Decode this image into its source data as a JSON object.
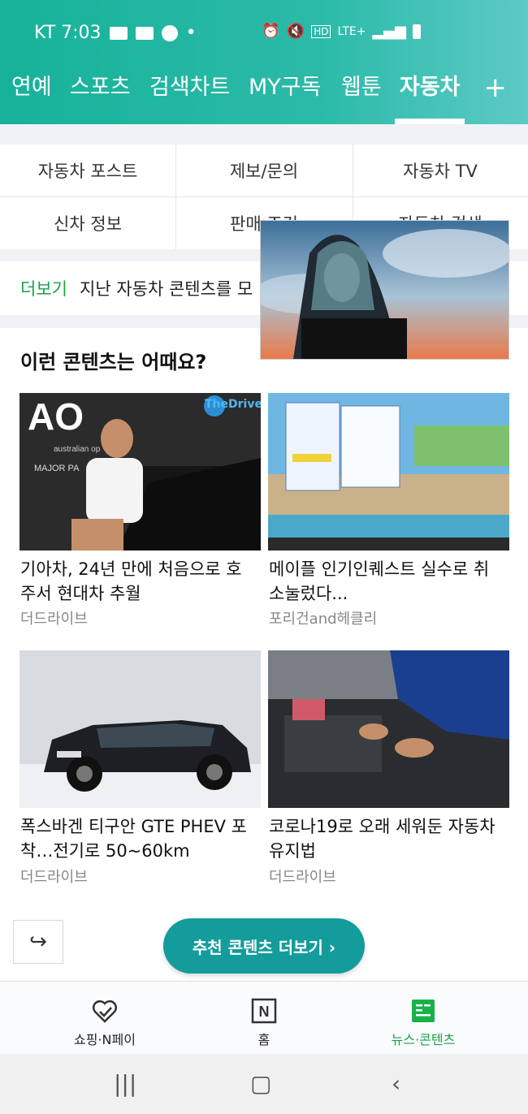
{
  "status_bar": {
    "carrier_time": "KT 7:03",
    "network": "LTE+",
    "hd": "HD"
  },
  "tabs": [
    {
      "label": "연예"
    },
    {
      "label": "스포츠"
    },
    {
      "label": "검색차트"
    },
    {
      "label": "MY구독"
    },
    {
      "label": "웹툰"
    },
    {
      "label": "자동차",
      "active": true
    }
  ],
  "add_tab_label": "+",
  "menu": {
    "row1": [
      "자동차 포스트",
      "제보/문의",
      "자동차 TV"
    ],
    "row2": [
      "신차 정보",
      "판매 조건",
      "자동차 검색"
    ]
  },
  "more_bar": {
    "keyword": "더보기",
    "text": "지난 자동차 콘텐츠를 모"
  },
  "section_heading": "이런 콘텐츠는 어때요?",
  "cards": [
    {
      "title": "기아차, 24년 만에 처음으로 호주서 현대차 추월",
      "source": "더드라이브",
      "image_text": "TheDrive"
    },
    {
      "title": "메이플 인기인퀘스트 실수로 취소눌렀다...",
      "source": "포리건and헤클리"
    },
    {
      "title": "폭스바겐 티구안 GTE PHEV 포착…전기로 50~60km",
      "source": "더드라이브"
    },
    {
      "title": "코로나19로 오래 세워둔 자동차 유지법",
      "source": "더드라이브"
    }
  ],
  "share_icon": "share-icon",
  "more_button_label": "추천 콘텐츠 더보기 ›",
  "bottom_nav": [
    {
      "label": "쇼핑·N페이",
      "icon": "heart-check-icon"
    },
    {
      "label": "홈",
      "icon": "n-logo-icon"
    },
    {
      "label": "뉴스·콘텐츠",
      "icon": "news-icon",
      "active": true
    }
  ],
  "colors": {
    "accent": "#19a24a",
    "header": "#2bbaa8",
    "button": "#149c9c"
  }
}
